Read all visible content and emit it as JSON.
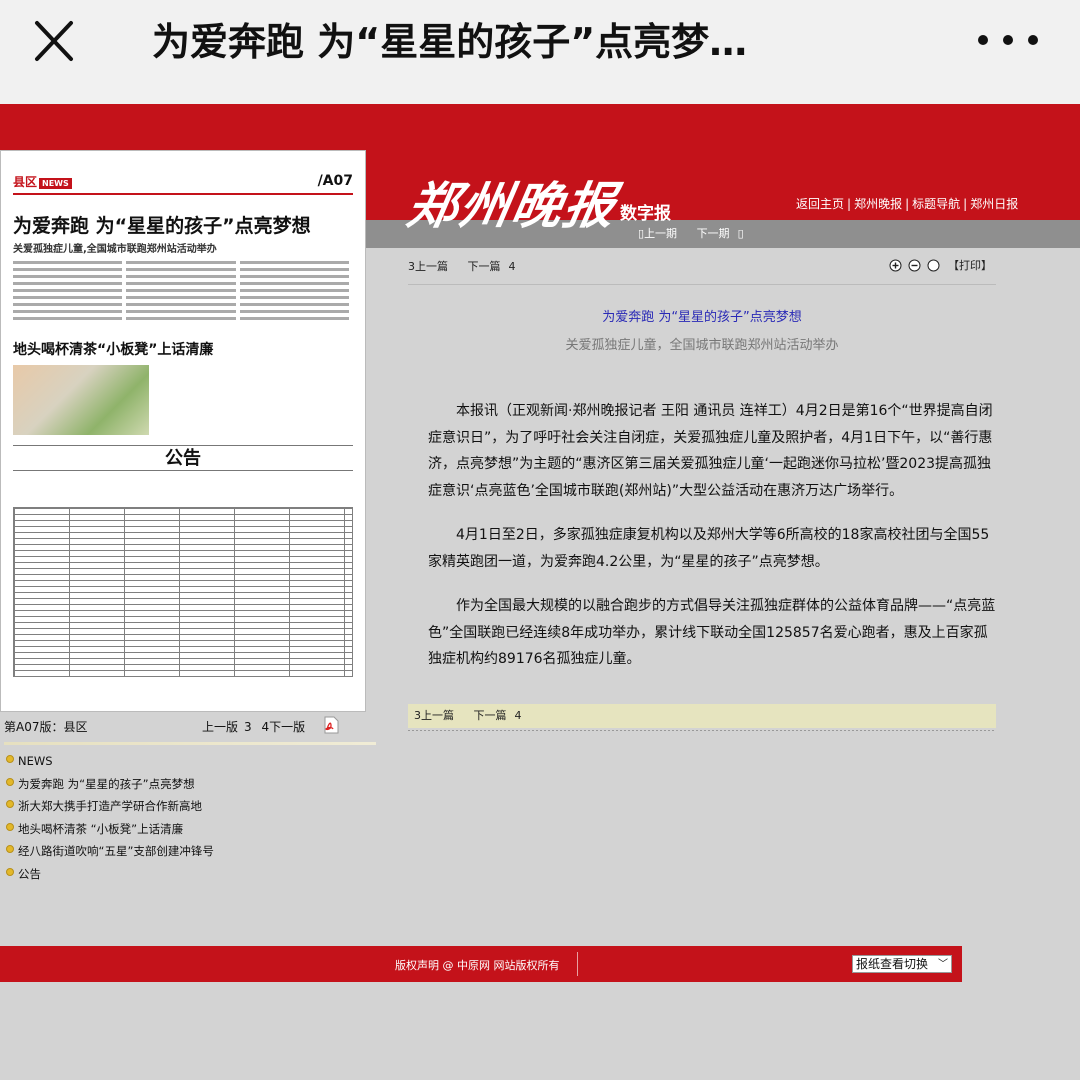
{
  "appbar": {
    "title": "为爱奔跑 为“星星的孩子”点亮梦…"
  },
  "masthead": {
    "brand_logo": "郑州晚报",
    "brand_sub": "数字报",
    "nav": [
      "返回主页",
      "郑州晚报",
      "标题导航",
      "郑州日报"
    ],
    "issue_prev": "上一期",
    "issue_next": "下一期"
  },
  "paper": {
    "section": "县区",
    "section_tag": "NEWS",
    "page_no": "/A07",
    "headline": "为爱奔跑 为“星星的孩子”点亮梦想",
    "subheadline": "关爱孤独症儿童,全国城市联跑郑州站活动举办",
    "story2": "地头喝杯清茶“小板凳”上话清廉",
    "notice": "公告",
    "footer_label": "第A07版：县区",
    "footer_prev": "上一版",
    "footer_next": "下一版"
  },
  "article_list": [
    "NEWS",
    "为爱奔跑 为“星星的孩子”点亮梦想",
    "浙大郑大携手打造产学研合作新高地",
    "地头喝杯清茶 “小板凳”上话清廉",
    "经八路街道吹响“五星”支部创建冲锋号",
    "公告"
  ],
  "article": {
    "prev": "上一篇",
    "next": "下一篇",
    "print": "【打印】",
    "title": "为爱奔跑 为“星星的孩子”点亮梦想",
    "subtitle": "关爱孤独症儿童，全国城市联跑郑州站活动举办",
    "paragraphs": [
      "本报讯（正观新闻·郑州晚报记者 王阳 通讯员 连祥工）4月2日是第16个“世界提高自闭症意识日”，为了呼吁社会关注自闭症，关爱孤独症儿童及照护者，4月1日下午，以“善行惠济，点亮梦想”为主题的“惠济区第三届关爱孤独症儿童‘一起跑迷你马拉松’暨2023提高孤独症意识‘点亮蓝色’全国城市联跑(郑州站)”大型公益活动在惠济万达广场举行。",
      "4月1日至2日，多家孤独症康复机构以及郑州大学等6所高校的18家高校社团与全国55家精英跑团一道，为爱奔跑4.2公里，为“星星的孩子”点亮梦想。",
      "作为全国最大规模的以融合跑步的方式倡导关注孤独症群体的公益体育品牌——“点亮蓝色”全国联跑已经连续8年成功举办，累计线下联动全国125857名爱心跑者，惠及上百家孤独症机构约89176名孤独症儿童。"
    ]
  },
  "footer": {
    "copyright": "版权声明 @ 中原网 网站版权所有",
    "switch_label": "报纸查看切换"
  },
  "colors": {
    "brand_red": "#c4121a",
    "title_blue": "#2a2ab6"
  }
}
